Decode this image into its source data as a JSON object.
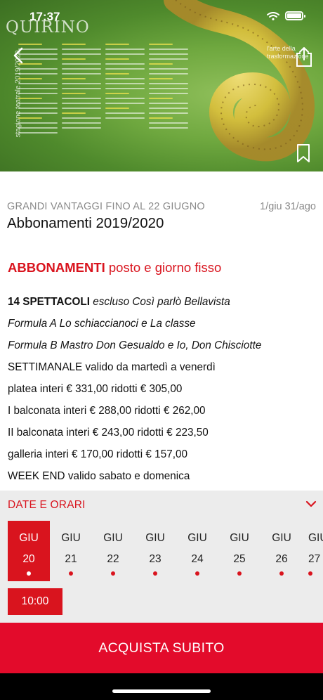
{
  "status_bar": {
    "time": "17:37"
  },
  "hero": {
    "logo": "QUIRINO",
    "season_label": "stagione teatrale 2019/2020",
    "tagline": "l'arte della trasformazione"
  },
  "info": {
    "promo": "GRANDI VANTAGGI FINO AL 22 GIUGNO",
    "date_range": "1/giu 31/ago",
    "title": "Abbonamenti 2019/2020"
  },
  "section": {
    "title_bold": "ABBONAMENTI",
    "title_rest": " posto e giorno fisso"
  },
  "body": {
    "line1_bold": "14 SPETTACOLI",
    "line1_italic": " escluso Così parlò Bellavista",
    "line2": "Formula A Lo schiaccianoci e La classe",
    "line3": "Formula B Mastro Don Gesualdo e Io, Don Chisciotte",
    "line4": "SETTIMANALE valido da martedì a venerdì",
    "line5": "platea interi € 331,00 ridotti € 305,00",
    "line6": "I balconata interi € 288,00 ridotti € 262,00",
    "line7": "II balconata interi € 243,00 ridotti € 223,50",
    "line8": "galleria interi € 170,00 ridotti € 157,00",
    "line9": "WEEK END valido sabato e domenica"
  },
  "dates": {
    "header": "DATE E ORARI",
    "days": [
      {
        "month": "GIU",
        "day": "20"
      },
      {
        "month": "GIU",
        "day": "21"
      },
      {
        "month": "GIU",
        "day": "22"
      },
      {
        "month": "GIU",
        "day": "23"
      },
      {
        "month": "GIU",
        "day": "24"
      },
      {
        "month": "GIU",
        "day": "25"
      },
      {
        "month": "GIU",
        "day": "26"
      },
      {
        "month": "GIU",
        "day": "27"
      }
    ],
    "selected_time": "10:00"
  },
  "cta": {
    "label": "ACQUISTA SUBITO"
  },
  "colors": {
    "accent": "#d9141e",
    "cta": "#e30b2b",
    "panel": "#ececec"
  }
}
